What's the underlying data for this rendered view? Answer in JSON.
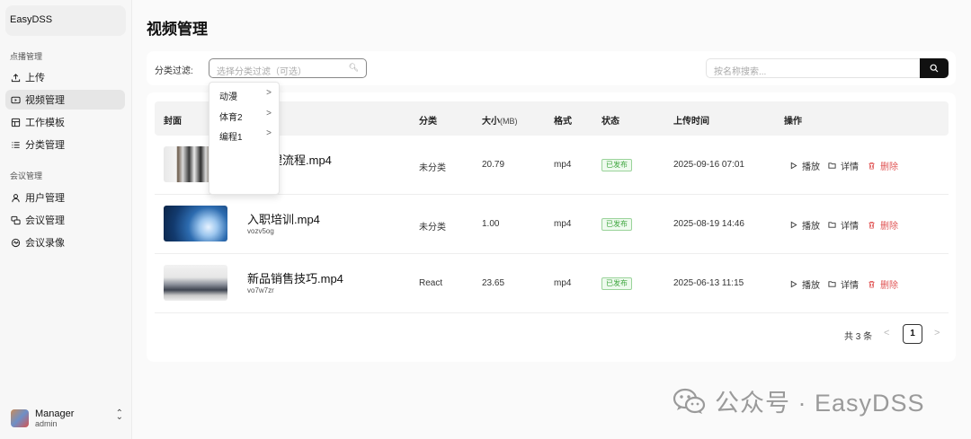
{
  "sidebar": {
    "brand": "EasyDSS",
    "sections": [
      {
        "label": "点播管理",
        "items": [
          {
            "label": "上传",
            "icon": "upload-icon"
          },
          {
            "label": "视频管理",
            "icon": "video-icon",
            "active": true
          },
          {
            "label": "工作模板",
            "icon": "template-icon"
          },
          {
            "label": "分类管理",
            "icon": "list-icon"
          }
        ]
      },
      {
        "label": "会议管理",
        "items": [
          {
            "label": "用户管理",
            "icon": "user-icon"
          },
          {
            "label": "会议管理",
            "icon": "meeting-icon"
          },
          {
            "label": "会议录像",
            "icon": "recording-icon"
          }
        ]
      }
    ],
    "user": {
      "name": "Manager",
      "role": "admin"
    }
  },
  "page": {
    "title": "视频管理"
  },
  "filter": {
    "label": "分类过滤:",
    "select_placeholder": "选择分类过滤（可选）",
    "search_placeholder": "按名称搜索..."
  },
  "dropdown": {
    "options": [
      "动漫",
      "体育2",
      "编程1"
    ]
  },
  "table": {
    "headers": {
      "cover": "封面",
      "category": "分类",
      "size": "大小",
      "size_unit": "(MB)",
      "format": "格式",
      "status": "状态",
      "upload_time": "上传时间",
      "actions": "操作"
    },
    "rows": [
      {
        "name": "议处理流程.mp4",
        "id": "",
        "category": "未分类",
        "size": "20.79",
        "format": "mp4",
        "status": "已发布",
        "time": "2025-09-16 07:01"
      },
      {
        "name": "入职培训.mp4",
        "id": "vozv5og",
        "category": "未分类",
        "size": "1.00",
        "format": "mp4",
        "status": "已发布",
        "time": "2025-08-19 14:46"
      },
      {
        "name": "新品销售技巧.mp4",
        "id": "vo7w7zr",
        "category": "React",
        "size": "23.65",
        "format": "mp4",
        "status": "已发布",
        "time": "2025-06-13 11:15"
      }
    ],
    "actions": {
      "play": "播放",
      "detail": "详情",
      "delete": "删除"
    }
  },
  "pagination": {
    "total": "共 3 条",
    "page": "1",
    "prev": "<",
    "next": ">"
  },
  "watermark": "公众号 · EasyDSS",
  "colors": {
    "accent": "#111111",
    "published_badge": "#3fa63f",
    "delete": "#e05555",
    "active_nav": "#e6e6e6"
  }
}
